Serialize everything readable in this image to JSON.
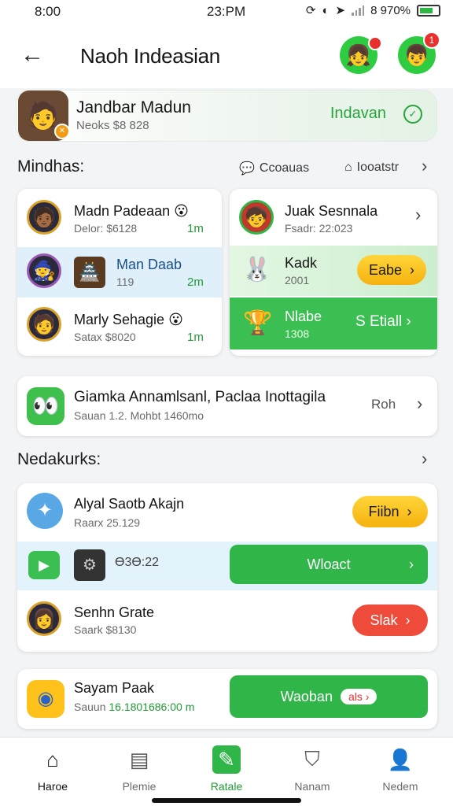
{
  "status_bar": {
    "time_left": "8:00",
    "time_center": "23:PM",
    "battery_text": "8 970%"
  },
  "header": {
    "title": "Naoh Indeasian",
    "back_icon": "arrow-left-icon",
    "avatar1_badge": "",
    "avatar2_badge": "1"
  },
  "profile": {
    "name": "Jandbar Madun",
    "sub": "Neoks $8 828",
    "action": "Indavan",
    "check_icon": "check-circle-icon"
  },
  "section1": {
    "title": "Mindhas:",
    "link1": "Ccoauas",
    "link2": "Iooatstr"
  },
  "left_card": {
    "rows": [
      {
        "name": "Madn Padeaan",
        "sub": "Delor: $6128",
        "time": "1m",
        "emoji": "😮"
      },
      {
        "name": "Man Daab",
        "sub": "119",
        "time": "2m"
      },
      {
        "name": "Marly Sehagie",
        "sub": "Satax $8020",
        "time": "1m",
        "emoji": "😮"
      }
    ]
  },
  "right_card": {
    "rows": [
      {
        "name": "Juak Sesnnala",
        "sub": "Fsadr: 22:023"
      },
      {
        "name": "Kadk",
        "sub": "2001",
        "button": "Eabe"
      },
      {
        "name": "Nlabe",
        "sub": "1308",
        "button": "S Etiall"
      }
    ]
  },
  "banner": {
    "title": "Giamka Annamlsanl, Paclaa Inottagila",
    "sub": "Sauan 1.2. Mohbt 1460mo",
    "action": "Roh"
  },
  "section2": {
    "title": "Nedakurks:"
  },
  "list2": {
    "rows": [
      {
        "name": "Alyal Saotb Akajn",
        "sub": "Raarx 25.129",
        "button": "Fiibn"
      },
      {
        "name": "",
        "sub": "Ө3Ө:22",
        "button": "Wloact"
      },
      {
        "name": "Senhn Grate",
        "sub": "Saark $8130",
        "button": "Slak"
      }
    ]
  },
  "bottom_item": {
    "name": "Sayam Paak",
    "sub_prefix": "Sauun",
    "sub_value": "16.1801686:00 m",
    "button": "Waoban",
    "button_tag": "als"
  },
  "nav": {
    "items": [
      {
        "label": "Haroe",
        "icon": "home-icon",
        "active": false
      },
      {
        "label": "Plemie",
        "icon": "list-icon",
        "active": false
      },
      {
        "label": "Ratale",
        "icon": "edit-icon",
        "active": true
      },
      {
        "label": "Nanam",
        "icon": "shield-home-icon",
        "active": false
      },
      {
        "label": "Nedem",
        "icon": "user-icon",
        "active": false
      }
    ]
  },
  "colors": {
    "accent_green": "#2fb548",
    "yellow": "#f5b20e",
    "red": "#ef4b3a"
  }
}
